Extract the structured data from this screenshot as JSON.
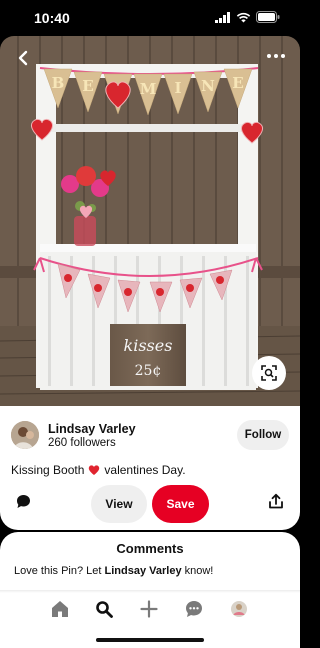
{
  "status_bar": {
    "time": "10:40"
  },
  "pin": {
    "sign_letters": [
      "B",
      "E",
      "M",
      "I",
      "N",
      "E"
    ],
    "chalk_sign": {
      "line1": "kisses",
      "line2": "25¢"
    }
  },
  "creator": {
    "name": "Lindsay Varley",
    "followers": "260 followers",
    "follow_label": "Follow"
  },
  "description": {
    "before": "Kissing Booth",
    "emoji": "red-heart-emoji",
    "after": "valentines Day."
  },
  "actions": {
    "view_label": "View",
    "save_label": "Save"
  },
  "comments": {
    "title": "Comments",
    "prompt_before": "Love this Pin? Let ",
    "prompt_name": "Lindsay Varley",
    "prompt_after": " know!"
  },
  "nav": {
    "items": [
      "home-icon",
      "search-icon",
      "create-icon",
      "messages-icon",
      "profile-avatar"
    ]
  },
  "colors": {
    "save": "#e60023",
    "accent_pink": "#e8528a",
    "heart_red": "#d8262e"
  }
}
